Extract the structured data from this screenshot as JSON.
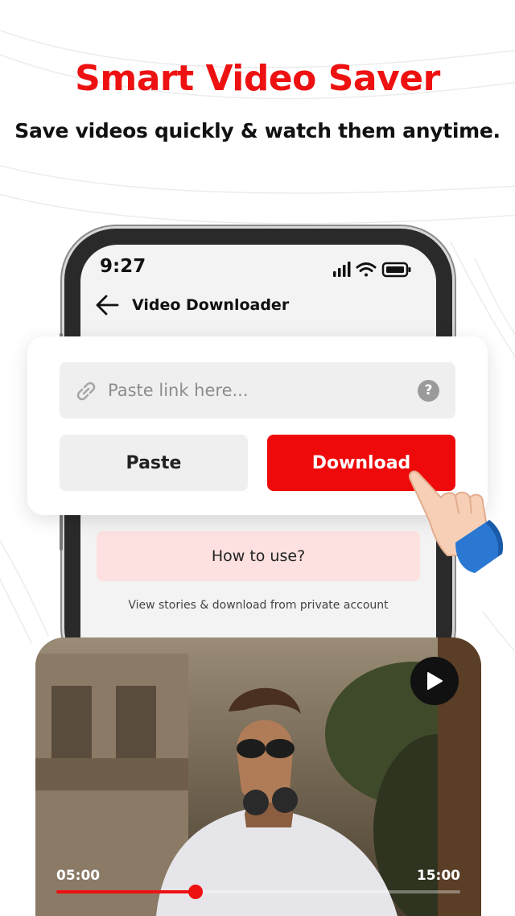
{
  "headline": "Smart Video Saver",
  "subheadline": "Save videos quickly & watch them anytime.",
  "phone": {
    "status_time": "9:27",
    "status_icons": [
      "signal-icon",
      "wifi-icon",
      "battery-icon"
    ],
    "nav_title": "Video Downloader",
    "howto_label": "How to use?",
    "info_text": "View stories & download from private account"
  },
  "card": {
    "link_placeholder": "Paste link here...",
    "help_symbol": "?",
    "paste_label": "Paste",
    "download_label": "Download"
  },
  "video": {
    "current_time": "05:00",
    "total_time": "15:00",
    "progress": 0.345
  },
  "colors": {
    "accent": "#ee0a0a",
    "howto_bg": "#fde0e0",
    "input_bg": "#efefef"
  }
}
